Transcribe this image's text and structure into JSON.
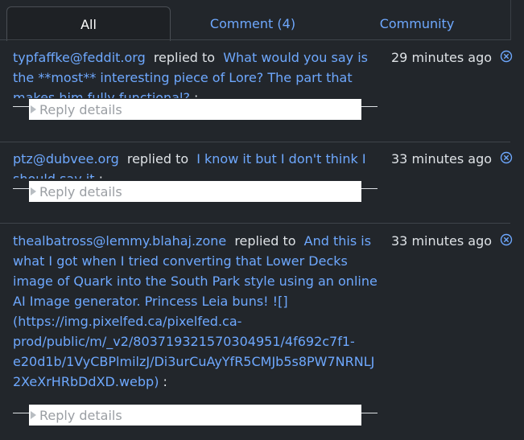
{
  "tabs": {
    "all": "All",
    "comment": "Comment (4)",
    "community": "Community"
  },
  "items": [
    {
      "user": "typfaffke@feddit.org",
      "replied_to": "replied to",
      "post": "What would you say is the **most** interesting piece of Lore? The part that makes him fully functional?",
      "suffix": " :",
      "time": "29 minutes ago",
      "reply_details": "Reply details"
    },
    {
      "user": "ptz@dubvee.org",
      "replied_to": "replied to",
      "post": "I know it but I don't think I should say it",
      "suffix": " :",
      "time": "33 minutes ago",
      "reply_details": "Reply details"
    },
    {
      "user": "thealbatross@lemmy.blahaj.zone",
      "replied_to": "replied to",
      "post": "And this is what I got when I tried converting that Lower Decks image of Quark into the South Park style using an online AI Image generator. Princess Leia buns! ![](https://img.pixelfed.ca/pixelfed.ca-prod/public/m/_v2/803719321570304951/4f692c7f1-e20d1b/1VyCBPlmilzJ/Di3urCuAyYfR5CMJb5s8PW7NRNLJ2XeXrHRbDdXD.webp)",
      "suffix": " :",
      "time": "33 minutes ago",
      "reply_details": "Reply details"
    }
  ],
  "colors": {
    "background": "#22262b",
    "link": "#6ea8fe",
    "text": "#dee2e6",
    "divider": "#3f444a"
  },
  "icons": {
    "dismiss": "close-circle-icon",
    "disclosure": "triangle-right-icon"
  }
}
